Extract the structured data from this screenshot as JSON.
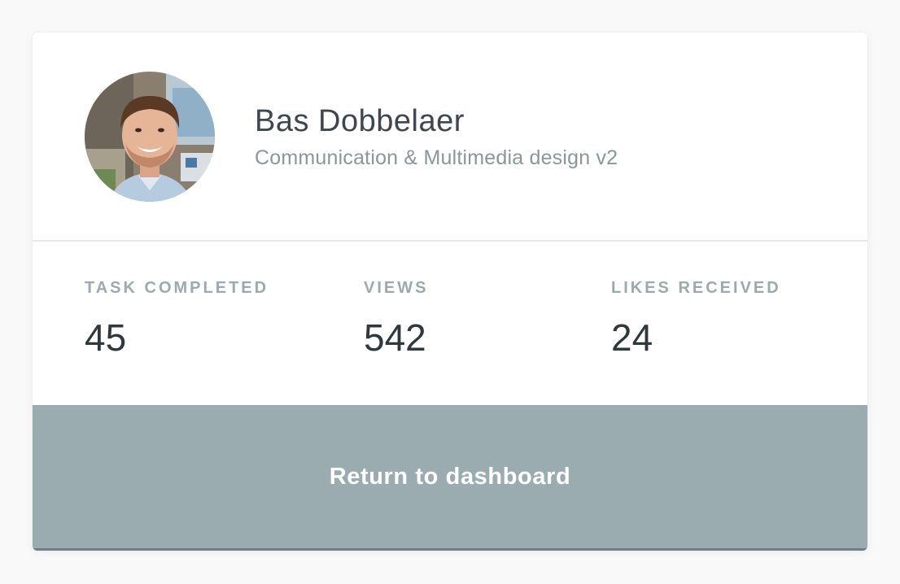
{
  "profile": {
    "name": "Bas Dobbelaer",
    "subtitle": "Communication & Multimedia design v2"
  },
  "stats": [
    {
      "label": "TASK COMPLETED",
      "value": "45"
    },
    {
      "label": "VIEWS",
      "value": "542"
    },
    {
      "label": "LIKES RECEIVED",
      "value": "24"
    }
  ],
  "action": {
    "label": "Return to dashboard"
  },
  "colors": {
    "card_background": "#ffffff",
    "button_background": "#9bacb1",
    "button_border": "#6f7f85",
    "name_text": "#3e474d",
    "label_text": "#9aaab0",
    "value_text": "#2f383d"
  }
}
